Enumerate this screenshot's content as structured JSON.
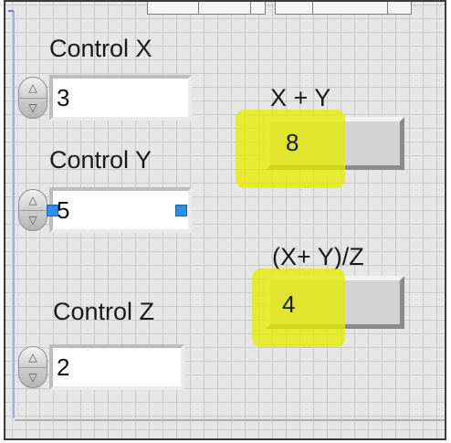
{
  "controls": {
    "x": {
      "label": "Control X",
      "value": "3"
    },
    "y": {
      "label": "Control Y",
      "value": "5"
    },
    "z": {
      "label": "Control Z",
      "value": "2"
    }
  },
  "indicators": {
    "sum": {
      "label": "X + Y",
      "value": "8"
    },
    "ratio": {
      "label": "(X+ Y)/Z",
      "value": "4"
    }
  },
  "colors": {
    "highlight": "#e6eb00",
    "selection_handle": "#2f8ee6",
    "panel_grid": "#c9c9c9"
  },
  "icons": {
    "increment": "up-arrow",
    "decrement": "down-arrow"
  }
}
